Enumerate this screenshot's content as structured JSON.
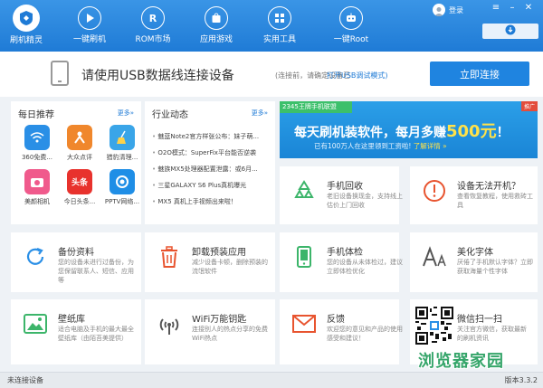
{
  "brand": {
    "name": "刷机精灵"
  },
  "nav": [
    {
      "label": "一键刷机"
    },
    {
      "label": "ROM市场"
    },
    {
      "label": "应用游戏"
    },
    {
      "label": "实用工具"
    }
  ],
  "nav_root": {
    "label": "一键Root"
  },
  "user": {
    "login_label": "登录"
  },
  "connect": {
    "main_text": "请使用USB数据线连接设备",
    "hint_text": "(连接前，请确定设备已",
    "link_text": "打开USB调试模式)",
    "button_label": "立即连接"
  },
  "daily": {
    "title": "每日推荐",
    "more": "更多»",
    "apps": [
      {
        "label": "360免费...",
        "icon": "wifi-icon",
        "color": "#2a8fe6"
      },
      {
        "label": "大众点评",
        "icon": "dianping-icon",
        "color": "#f0872c"
      },
      {
        "label": "猎豹清理...",
        "icon": "broom-icon",
        "color": "#3aa5e8"
      },
      {
        "label": "美颜相机",
        "icon": "camera-icon",
        "color": "#f05a8c"
      },
      {
        "label": "今日头条...",
        "icon": "toutiao-icon",
        "color": "#e8322d"
      },
      {
        "label": "PPTV网络...",
        "icon": "pptv-icon",
        "color": "#1f8ee6"
      }
    ]
  },
  "industry": {
    "title": "行业动态",
    "more": "更多»",
    "news": [
      "魅蓝Note2官方样张公布：妹子萌...",
      "O2O模式：SuperFix平台能否逆袭",
      "魅族MX5处理器配置泄露：或6月...",
      "三星GALAXY S6 Plus真机曝光",
      "MX5 真机上手视频出来啦！"
    ]
  },
  "ad": {
    "tag": "2345王牌手机联盟",
    "corner": "推广",
    "main_text": "每天刷机装软件，每月多赚",
    "money": "500元",
    "money_suffix": "！",
    "sub_text": "已有100万人在这里领到工资啦!",
    "go": "了解详情 »"
  },
  "tiles": [
    {
      "title": "手机回收",
      "desc": "老旧设备换现金，支持线上估价上门回收",
      "icon": "recycle-icon"
    },
    {
      "title": "设备无法开机？",
      "desc": "查看恢复教程，使用救砖工具",
      "icon": "warning-icon"
    },
    {
      "title": "备份资料",
      "desc": "您的设备未进行过备份，为您保留联系人、短信、应用等",
      "icon": "backup-icon"
    },
    {
      "title": "卸载预装应用",
      "desc": "减少设备卡顿，删除预装的流氓软件",
      "icon": "trash-icon"
    },
    {
      "title": "手机体检",
      "desc": "您的设备从未体检过，建议立即体检优化",
      "icon": "phone-check-icon"
    },
    {
      "title": "美化字体",
      "desc": "厌倦了手机默认字体？立即获取海量个性字体",
      "icon": "font-icon"
    },
    {
      "title": "壁纸库",
      "desc": "适合电脑及手机的最大最全壁纸库（由陌苔美提供）",
      "icon": "image-icon"
    },
    {
      "title": "WiFi万能钥匙",
      "desc": "连接别人的热点分享的免费WiFi热点",
      "icon": "wifi-key-icon"
    },
    {
      "title": "反馈",
      "desc": "欢迎您的意见和产品的使用感受和建议！",
      "icon": "mail-icon"
    },
    {
      "title": "微信扫一扫",
      "desc": "关注官方微信，获取最新的刷机资讯",
      "icon": "qr-code-icon"
    }
  ],
  "status": {
    "device_text": "未连接设备",
    "version": "版本3.3.2"
  },
  "watermark": "浏览器家园",
  "colors": {
    "primary": "#1f7bd6",
    "accent_green": "#35a56a",
    "accent_red": "#e34d3c"
  }
}
